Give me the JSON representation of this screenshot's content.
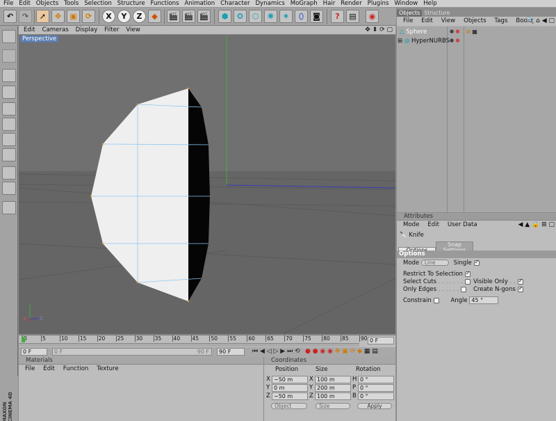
{
  "menu": [
    "File",
    "Edit",
    "Objects",
    "Tools",
    "Selection",
    "Structure",
    "Functions",
    "Animation",
    "Character",
    "Dynamics",
    "MoGraph",
    "Hair",
    "Render",
    "Plugins",
    "Window",
    "Help"
  ],
  "toolbar": {
    "x_label": "X",
    "y_label": "Y",
    "z_label": "Z"
  },
  "viewport": {
    "menu": [
      "Edit",
      "Cameras",
      "Display",
      "Filter",
      "View"
    ],
    "label": "Perspective",
    "axis_x": "X",
    "axis_y": "Y",
    "axis_z": "Z"
  },
  "timeline": {
    "ticks": [
      "0",
      "5",
      "10",
      "15",
      "20",
      "25",
      "30",
      "35",
      "40",
      "45",
      "50",
      "55",
      "60",
      "65",
      "70",
      "75",
      "80",
      "85",
      "90"
    ],
    "current_frame": "0 F",
    "start_frame": "0 F",
    "start_field": "0 F",
    "end_field": "90 F",
    "end_suffix": "90 F"
  },
  "objects_panel": {
    "tabs": [
      "Objects",
      "Structure"
    ],
    "menu": [
      "File",
      "Edit",
      "View",
      "Objects",
      "Tags",
      "Bookr"
    ],
    "items": [
      {
        "name": "Sphere"
      },
      {
        "name": "HyperNURBS"
      }
    ]
  },
  "attributes": {
    "header": "Attributes",
    "menu": [
      "Mode",
      "Edit",
      "User Data"
    ],
    "tool_name": "Knife",
    "tabs": [
      "Options",
      "Snap Settings"
    ],
    "section": "Options",
    "mode_label": "Mode",
    "mode_value": "Line",
    "single_label": "Single",
    "restrict_label": "Restrict To Selection",
    "select_cuts_label": "Select Cuts",
    "visible_only_label": "Visible Only",
    "only_edges_label": "Only Edges",
    "create_ngons_label": "Create N-gons",
    "constrain_label": "Constrain",
    "angle_label": "Angle",
    "angle_value": "45 °"
  },
  "materials": {
    "header": "Materials",
    "menu": [
      "File",
      "Edit",
      "Function",
      "Texture"
    ]
  },
  "coordinates": {
    "header": "Coordinates",
    "col_position": "Position",
    "col_size": "Size",
    "col_rotation": "Rotation",
    "rows": [
      {
        "axis": "X",
        "pos": "−50 m",
        "size_axis": "X",
        "size": "100 m",
        "rot_axis": "H",
        "rot": "0 °"
      },
      {
        "axis": "Y",
        "pos": "0 m",
        "size_axis": "Y",
        "size": "200 m",
        "rot_axis": "P",
        "rot": "0 °"
      },
      {
        "axis": "Z",
        "pos": "−50 m",
        "size_axis": "Z",
        "size": "100 m",
        "rot_axis": "B",
        "rot": "0 °"
      }
    ],
    "object_drop": "Object",
    "size_drop": "Size",
    "apply_label": "Apply"
  },
  "branding": {
    "line1": "MAXON",
    "line2": "CINEMA 4D"
  },
  "colors": {
    "accent": "#5b7daf",
    "viewport_bg": "#696969",
    "panel_bg": "#bdbdbd"
  }
}
